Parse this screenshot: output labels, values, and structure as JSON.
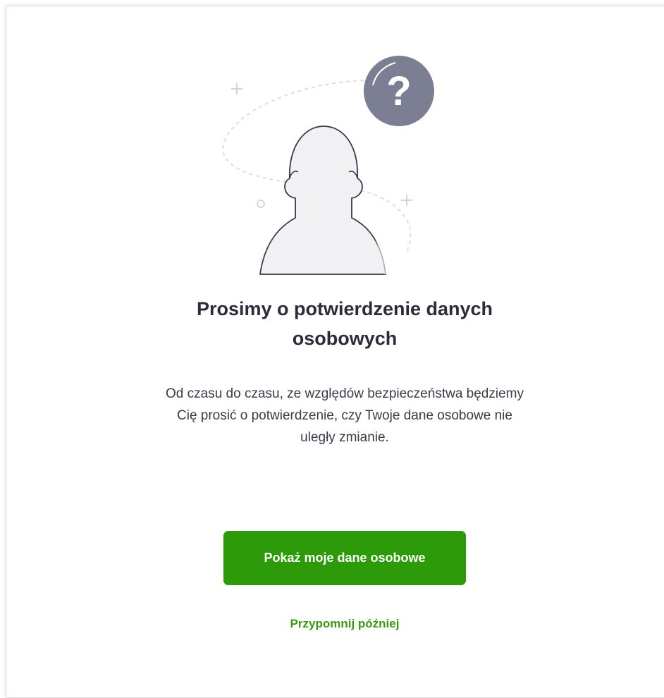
{
  "dialog": {
    "title": "Prosimy o potwierdzenie danych osobowych",
    "description": "Od czasu do czasu, ze względów bezpieczeństwa będziemy Cię prosić o potwierdzenie, czy Twoje dane osobowe nie uległy zmianie.",
    "primary_button_label": "Pokaż moje dane osobowe",
    "secondary_link_label": "Przypomnij później"
  },
  "illustration": {
    "badge_symbol": "?",
    "icons": [
      "person-silhouette-icon",
      "question-mark-icon",
      "plus-icon",
      "circle-icon"
    ]
  },
  "colors": {
    "primary": "#2d9a0a",
    "link": "#3a9a14",
    "badge": "#7c7f93",
    "silhouette": "#f1f1f3",
    "outline": "#3a3a48"
  }
}
